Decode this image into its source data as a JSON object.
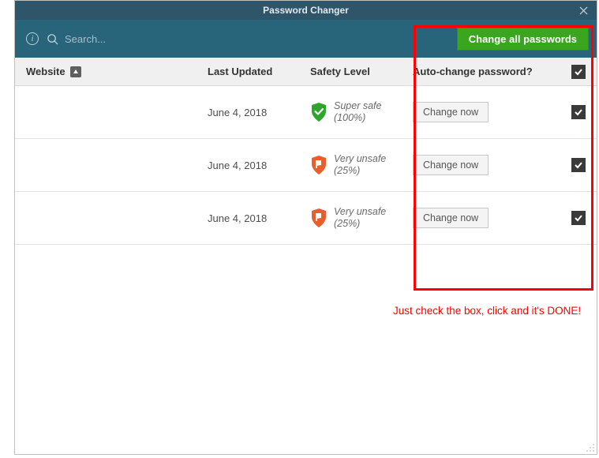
{
  "window": {
    "title": "Password Changer"
  },
  "toolbar": {
    "search_placeholder": "Search...",
    "info_glyph": "i",
    "change_all_label": "Change all passwords"
  },
  "columns": {
    "website": "Website",
    "last_updated": "Last Updated",
    "safety_level": "Safety Level",
    "auto_change": "Auto-change password?"
  },
  "header_check": true,
  "rows": [
    {
      "website": "",
      "last_updated": "June 4, 2018",
      "safety_label": "Super safe",
      "safety_percent": "(100%)",
      "safety_kind": "safe",
      "action_label": "Change now",
      "checked": true
    },
    {
      "website": "",
      "last_updated": "June 4, 2018",
      "safety_label": "Very unsafe",
      "safety_percent": "(25%)",
      "safety_kind": "unsafe",
      "action_label": "Change now",
      "checked": true
    },
    {
      "website": "",
      "last_updated": "June 4, 2018",
      "safety_label": "Very unsafe",
      "safety_percent": "(25%)",
      "safety_kind": "unsafe",
      "action_label": "Change now",
      "checked": true
    }
  ],
  "annotation": {
    "text": "Just check the box, click and it's DONE!"
  },
  "colors": {
    "titlebar": "#2f556a",
    "toolbar": "#28647a",
    "primary_action": "#3aa61f",
    "safe_shield": "#2fa52d",
    "unsafe_shield": "#e85f2c",
    "highlight": "#ff0000"
  }
}
